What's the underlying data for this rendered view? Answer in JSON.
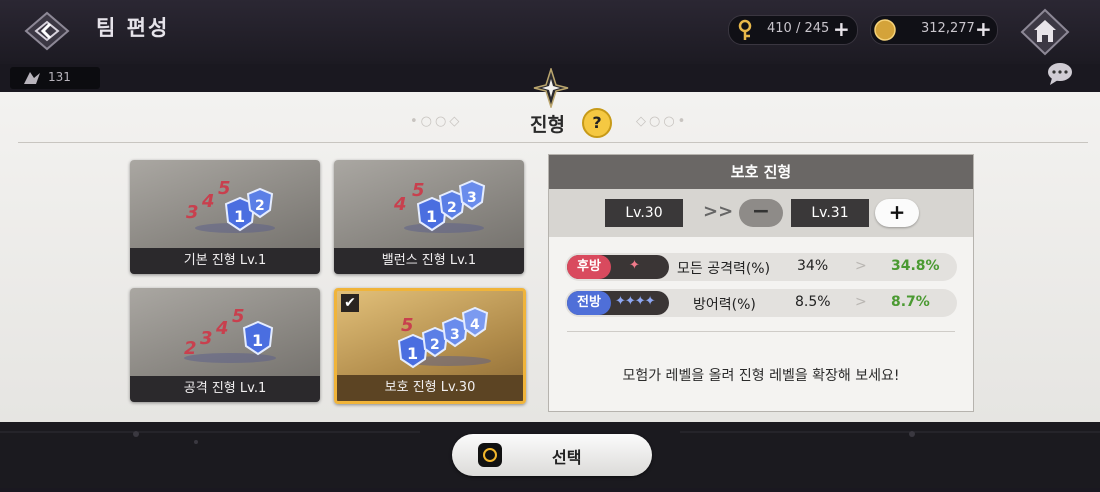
{
  "header": {
    "title": "팀 편성",
    "keys": "410 / 245",
    "gold": "312,277",
    "stamina": "131"
  },
  "panel": {
    "title": "진형",
    "help_label": "?"
  },
  "cards": [
    {
      "label": "기본 진형 Lv.1",
      "selected": false
    },
    {
      "label": "밸런스 진형 Lv.1",
      "selected": false
    },
    {
      "label": "공격 진형 Lv.1",
      "selected": false
    },
    {
      "label": "보호 진형 Lv.30",
      "selected": true
    }
  ],
  "detail": {
    "title": "보호 진형",
    "lv_current": "Lv.30",
    "lv_next": "Lv.31",
    "arrow": ">>",
    "minus": "−",
    "plus": "+",
    "rows": [
      {
        "pos": "후방",
        "stars": "✦",
        "pos_color": "#d94a5e",
        "stat": "모든 공격력(%)",
        "cur": "34%",
        "next": "34.8%"
      },
      {
        "pos": "전방",
        "stars": "✦✦✦✦",
        "pos_color": "#4f6fd8",
        "stat": "방어력(%)",
        "cur": "8.5%",
        "next": "8.7%"
      }
    ],
    "message": "모험가 레벨을 올려 진형 레벨을 확장해 보세요!"
  },
  "select_button": {
    "label": "선택"
  },
  "colors": {
    "selected_border": "#f0b43a",
    "bonus_green": "#4b9a32",
    "rear_red": "#d94a5e",
    "front_blue": "#4f6fd8"
  }
}
